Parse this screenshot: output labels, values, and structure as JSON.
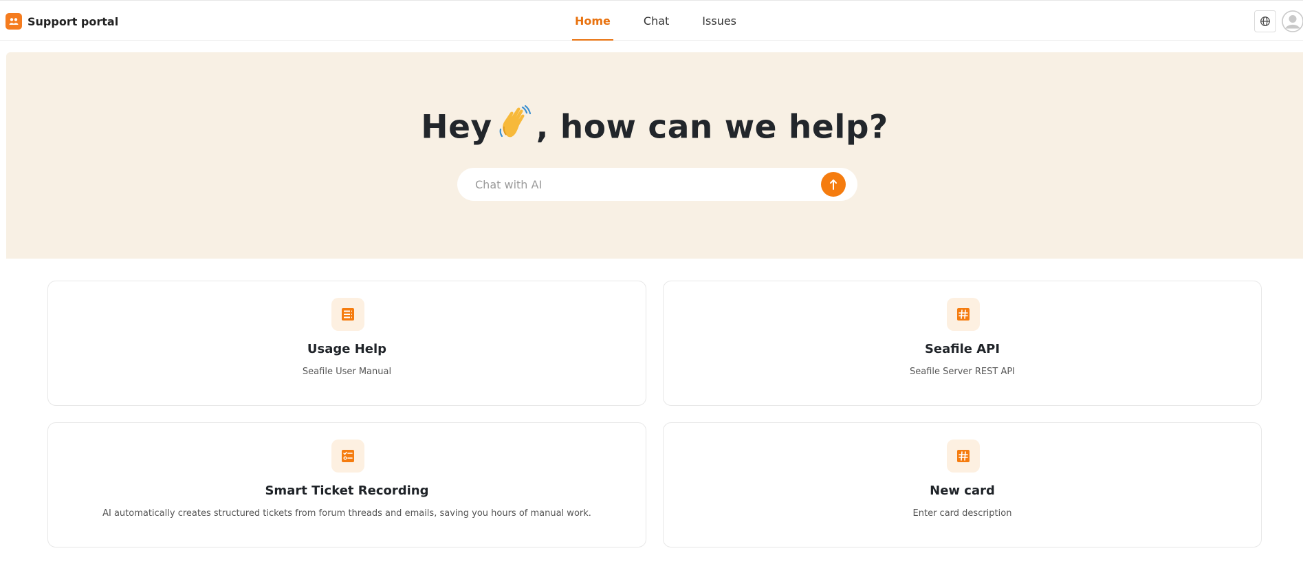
{
  "header": {
    "brand_title": "Support portal",
    "tabs": [
      {
        "label": "Home",
        "active": true
      },
      {
        "label": "Chat",
        "active": false
      },
      {
        "label": "Issues",
        "active": false
      }
    ],
    "language_icon": "globe-icon",
    "avatar_icon": "user-avatar-icon"
  },
  "hero": {
    "title_before": "Hey",
    "title_emoji": "waving-hand-icon",
    "title_after": ", how can we help?",
    "search_placeholder": "Chat with AI",
    "send_icon": "arrow-up-icon"
  },
  "cards": [
    {
      "title": "Usage Help",
      "description": "Seafile User Manual",
      "icon": "list-icon"
    },
    {
      "title": "Seafile API",
      "description": "Seafile Server REST API",
      "icon": "hash-icon"
    },
    {
      "title": "Smart Ticket Recording",
      "description": "AI automatically creates structured tickets from forum threads and emails, saving you hours of manual work.",
      "icon": "checklist-icon"
    },
    {
      "title": "New card",
      "description": "Enter card description",
      "icon": "hash-icon"
    }
  ],
  "colors": {
    "accent": "#f57c0f",
    "hero_background": "#f8f0e4",
    "icon_background": "#fdf0e1"
  }
}
